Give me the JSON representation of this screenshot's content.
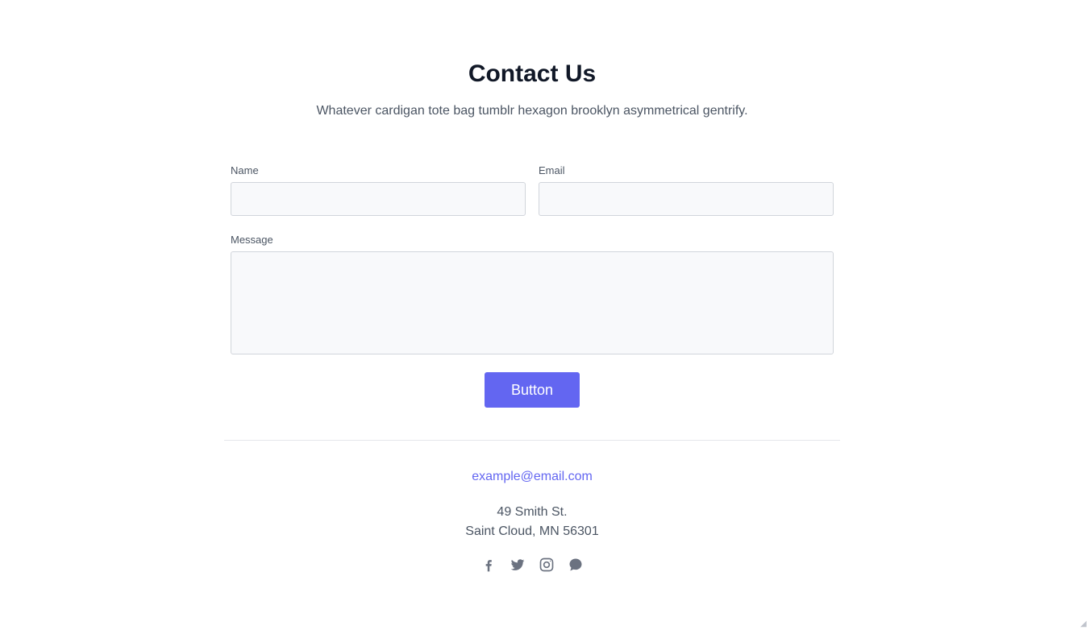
{
  "header": {
    "title": "Contact Us",
    "subtitle": "Whatever cardigan tote bag tumblr hexagon brooklyn asymmetrical gentrify."
  },
  "form": {
    "name_label": "Name",
    "name_value": "",
    "email_label": "Email",
    "email_value": "",
    "message_label": "Message",
    "message_value": "",
    "submit_label": "Button"
  },
  "footer": {
    "email": "example@email.com",
    "address_line1": "49 Smith St.",
    "address_line2": "Saint Cloud, MN 56301",
    "social_icons": [
      "facebook-icon",
      "twitter-icon",
      "instagram-icon",
      "chat-icon"
    ]
  },
  "colors": {
    "accent": "#6366f1",
    "title": "#111827",
    "text": "#4b5563",
    "input_bg": "#f8f9fb",
    "input_border": "#d1d5db",
    "icon": "#6b7280"
  }
}
